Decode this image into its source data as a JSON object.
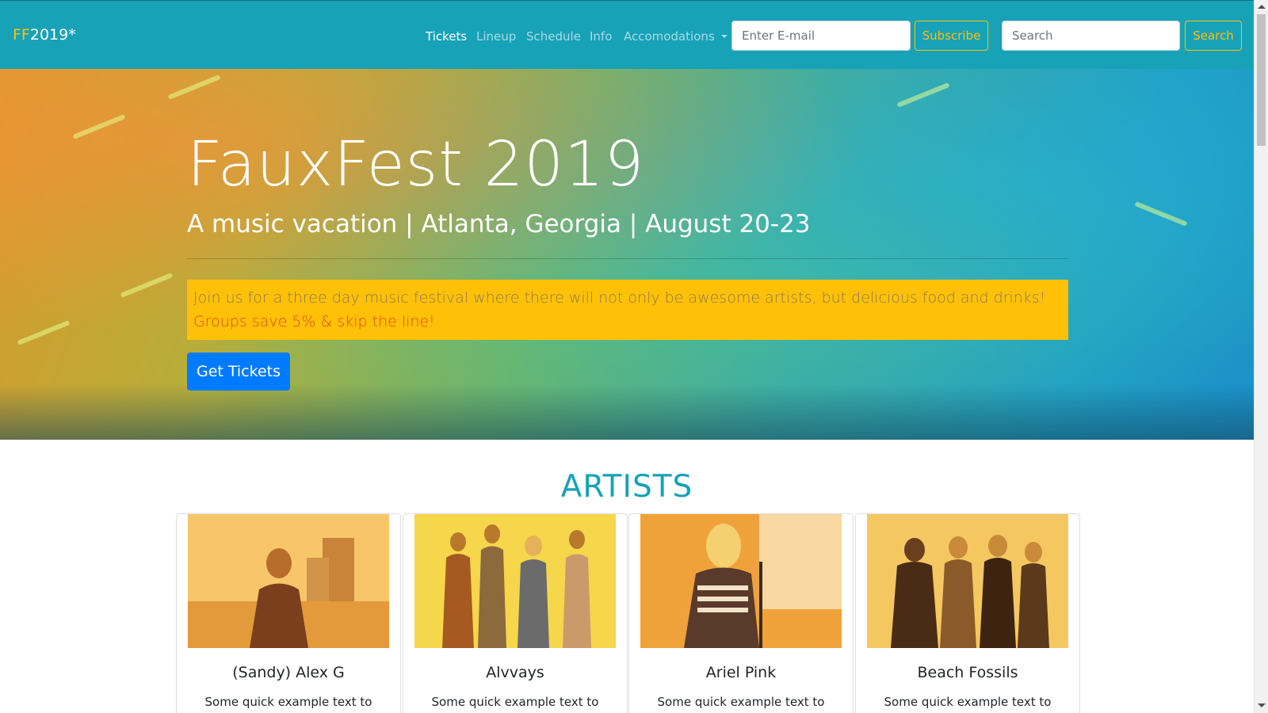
{
  "navbar": {
    "brand_prefix": "FF",
    "brand_suffix": "2019*",
    "links": [
      "Tickets",
      "Lineup",
      "Schedule",
      "Info",
      "Accomodations"
    ],
    "email_placeholder": "Enter E-mail",
    "subscribe_label": "Subscribe",
    "search_placeholder": "Search",
    "search_label": "Search"
  },
  "hero": {
    "title": "FauxFest 2019",
    "subtitle": "A music vacation | Atlanta, Georgia | August 20-23",
    "description": "Join us for a three day music festival where there will not only be awesome artists, but delicious food and drinks!",
    "promo": "Groups save 5% & skip the line!",
    "cta_label": "Get Tickets"
  },
  "artists": {
    "heading": "ARTISTS",
    "cards": [
      {
        "name": "(Sandy) Alex G",
        "text": "Some quick example text to"
      },
      {
        "name": "Alvvays",
        "text": "Some quick example text to"
      },
      {
        "name": "Ariel Pink",
        "text": "Some quick example text to"
      },
      {
        "name": "Beach Fossils",
        "text": "Some quick example text to"
      }
    ]
  },
  "colors": {
    "navbar": "#17a2b8",
    "accent": "#ffc107",
    "primary": "#007bff",
    "promo_text": "#e0451f"
  },
  "icons": {
    "dropdown": "chevron-down-icon",
    "scroll_up": "arrow-up-icon",
    "scroll_down": "arrow-down-icon"
  }
}
